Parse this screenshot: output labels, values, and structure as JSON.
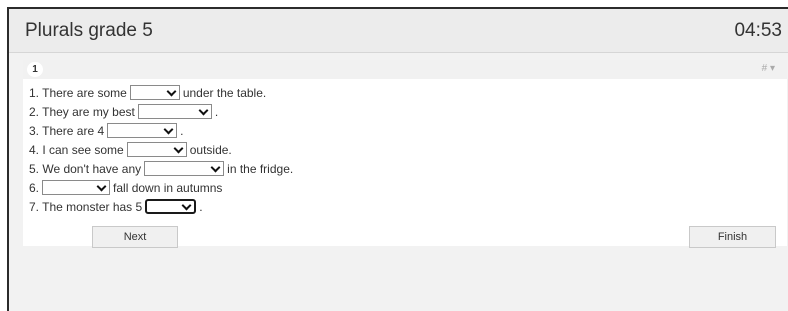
{
  "header": {
    "title": "Plurals grade 5",
    "timer": "04:53"
  },
  "question": {
    "number": "1",
    "flag_label": "# ▾"
  },
  "lines": [
    {
      "prefix": "1. There are some",
      "suffix": "under the table."
    },
    {
      "prefix": "2. They are my best",
      "suffix": "."
    },
    {
      "prefix": "3. There are 4",
      "suffix": "."
    },
    {
      "prefix": "4. I can see some",
      "suffix": "outside."
    },
    {
      "prefix": "5. We don't have any",
      "suffix": "in the fridge."
    },
    {
      "prefix": "6.",
      "suffix": "fall down in autumns"
    },
    {
      "prefix": "7. The monster has 5",
      "suffix": "."
    }
  ],
  "buttons": {
    "next": "Next",
    "finish": "Finish"
  }
}
